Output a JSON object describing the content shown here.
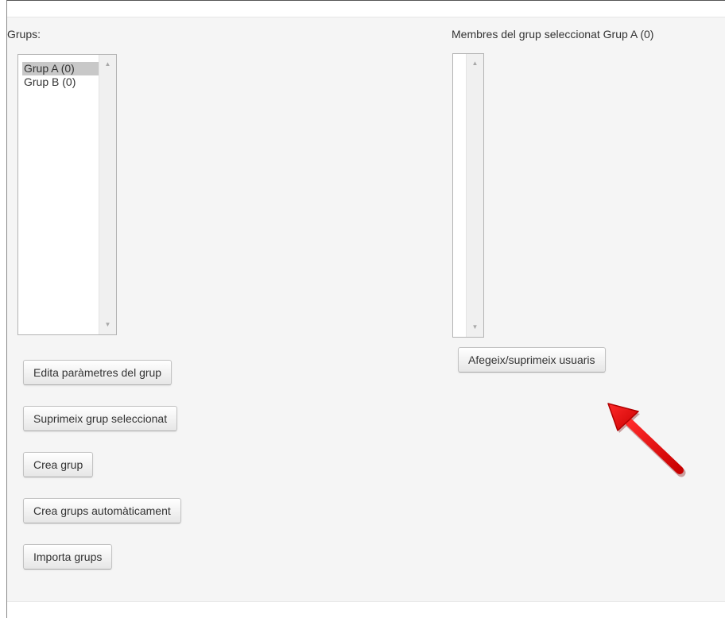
{
  "groups": {
    "label": "Grups:",
    "items": [
      {
        "label": "Grup A (0)",
        "selected": true
      },
      {
        "label": "Grup B (0)",
        "selected": false
      }
    ],
    "buttons": {
      "edit": "Edita paràmetres del grup",
      "delete": "Suprimeix grup seleccionat",
      "create": "Crea grup",
      "auto_create": "Crea grups automàticament",
      "import": "Importa grups"
    }
  },
  "members": {
    "label": "Membres del grup seleccionat Grup A (0)",
    "items": [],
    "button": "Afegeix/suprimeix usuaris"
  },
  "annotation": {
    "arrow_color": "#e00000"
  },
  "colors": {
    "panel_background": "#f5f5f5",
    "selected_option": "#c8c8c8"
  }
}
